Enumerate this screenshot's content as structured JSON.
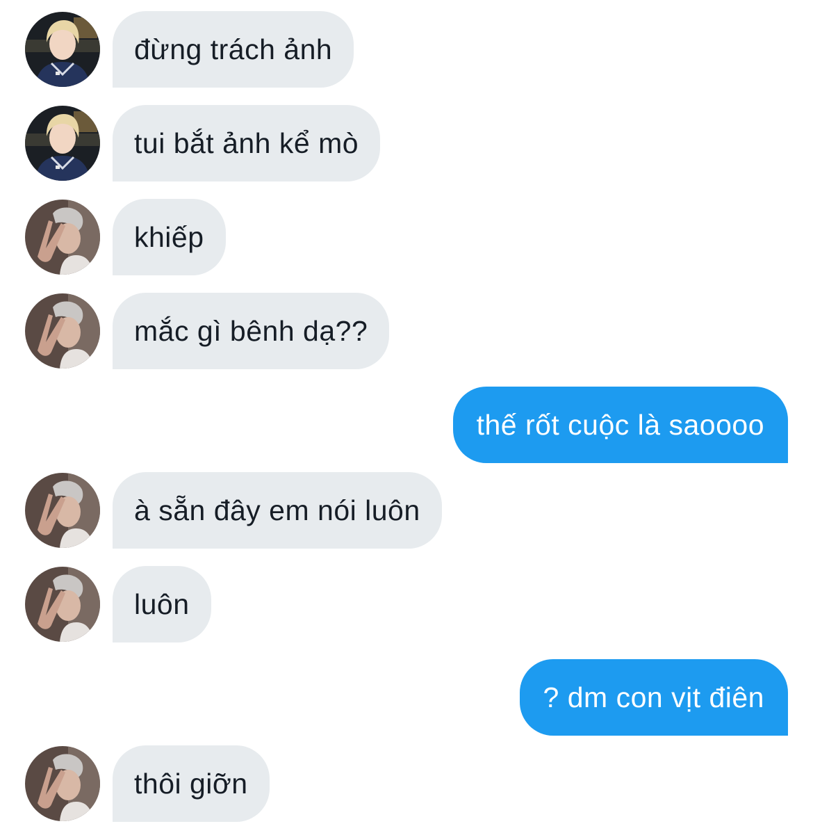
{
  "messages": [
    {
      "sender": "other",
      "avatar": "blonde-user-avatar",
      "text": "đừng trách ảnh"
    },
    {
      "sender": "other",
      "avatar": "blonde-user-avatar",
      "text": "tui bắt ảnh kể mò"
    },
    {
      "sender": "other",
      "avatar": "grey-hair-user-avatar",
      "text": "khiếp"
    },
    {
      "sender": "other",
      "avatar": "grey-hair-user-avatar",
      "text": "mắc gì bênh dạ??"
    },
    {
      "sender": "me",
      "text": "thế rốt cuộc là saoooo"
    },
    {
      "sender": "other",
      "avatar": "grey-hair-user-avatar",
      "text": "à sẵn đây em nói luôn"
    },
    {
      "sender": "other",
      "avatar": "grey-hair-user-avatar",
      "text": "luôn"
    },
    {
      "sender": "me",
      "text": "? dm con vịt điên"
    },
    {
      "sender": "other",
      "avatar": "grey-hair-user-avatar",
      "text": "thôi giỡn"
    }
  ],
  "colors": {
    "incoming_bubble": "#e7ebee",
    "incoming_text": "#161d26",
    "outgoing_bubble": "#1d9bf0",
    "outgoing_text": "#ffffff"
  }
}
